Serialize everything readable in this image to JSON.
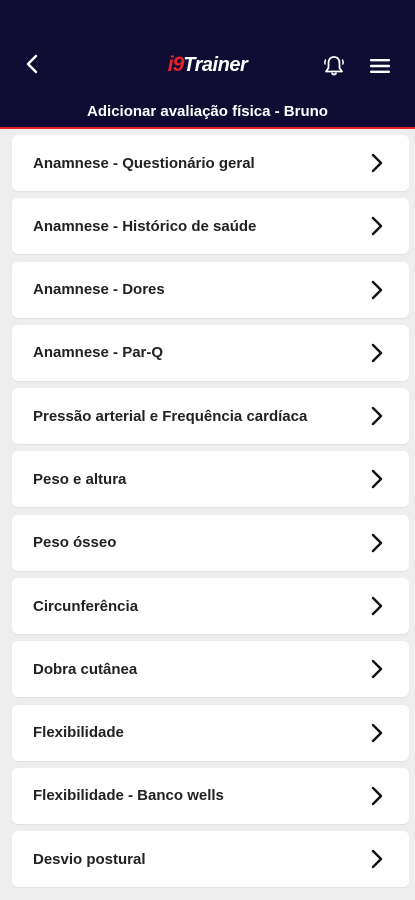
{
  "header": {
    "logo_mark": "i9",
    "logo_text": "Trainer",
    "subtitle": "Adicionar avaliação física - Bruno",
    "icons": {
      "back": "chevron-left-icon",
      "bell": "bell-icon",
      "menu": "hamburger-menu-icon"
    }
  },
  "colors": {
    "header_bg": "#0f0c33",
    "accent": "#e8202a",
    "page_bg": "#eeeeee"
  },
  "items": [
    {
      "label": "Anamnese - Questionário geral"
    },
    {
      "label": "Anamnese - Histórico de saúde"
    },
    {
      "label": "Anamnese - Dores"
    },
    {
      "label": "Anamnese - Par-Q"
    },
    {
      "label": "Pressão arterial e Frequência cardíaca"
    },
    {
      "label": "Peso e altura"
    },
    {
      "label": "Peso ósseo"
    },
    {
      "label": "Circunferência"
    },
    {
      "label": "Dobra cutânea"
    },
    {
      "label": "Flexibilidade"
    },
    {
      "label": "Flexibilidade - Banco wells"
    },
    {
      "label": "Desvio postural"
    }
  ]
}
